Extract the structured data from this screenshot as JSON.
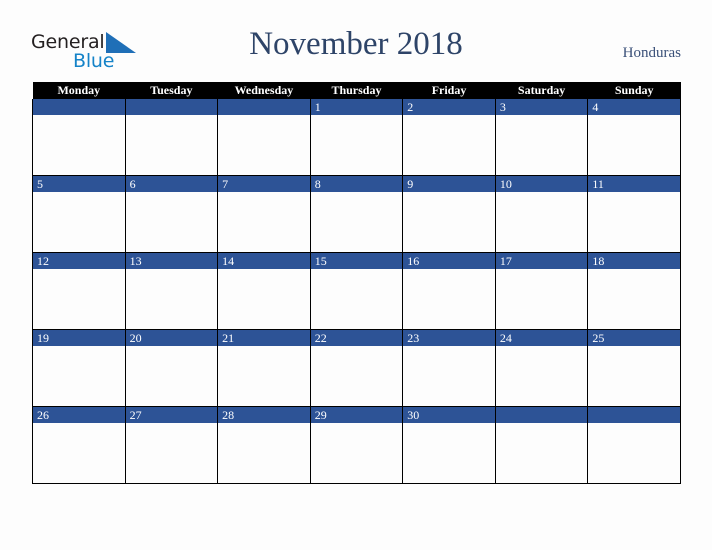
{
  "brand": {
    "name_part1": "General",
    "name_part2": "Blue",
    "triangle_icon": "blue-triangle-icon",
    "accent_color": "#1583c8",
    "text_color": "#231f20"
  },
  "header": {
    "title": "November 2018",
    "region": "Honduras",
    "title_color": "#2e4468",
    "region_color": "#3a5078"
  },
  "calendar": {
    "theme": {
      "header_background": "#000000",
      "header_text": "#ffffff",
      "daynum_band": "#2d5396",
      "daynum_text": "#ffffff",
      "cell_background": "#fdfdfd",
      "grid_line": "#000000"
    },
    "weekday_headers": [
      "Monday",
      "Tuesday",
      "Wednesday",
      "Thursday",
      "Friday",
      "Saturday",
      "Sunday"
    ],
    "weeks": [
      {
        "days": [
          {
            "num": ""
          },
          {
            "num": ""
          },
          {
            "num": ""
          },
          {
            "num": "1"
          },
          {
            "num": "2"
          },
          {
            "num": "3"
          },
          {
            "num": "4"
          }
        ]
      },
      {
        "days": [
          {
            "num": "5"
          },
          {
            "num": "6"
          },
          {
            "num": "7"
          },
          {
            "num": "8"
          },
          {
            "num": "9"
          },
          {
            "num": "10"
          },
          {
            "num": "11"
          }
        ]
      },
      {
        "days": [
          {
            "num": "12"
          },
          {
            "num": "13"
          },
          {
            "num": "14"
          },
          {
            "num": "15"
          },
          {
            "num": "16"
          },
          {
            "num": "17"
          },
          {
            "num": "18"
          }
        ]
      },
      {
        "days": [
          {
            "num": "19"
          },
          {
            "num": "20"
          },
          {
            "num": "21"
          },
          {
            "num": "22"
          },
          {
            "num": "23"
          },
          {
            "num": "24"
          },
          {
            "num": "25"
          }
        ]
      },
      {
        "days": [
          {
            "num": "26"
          },
          {
            "num": "27"
          },
          {
            "num": "28"
          },
          {
            "num": "29"
          },
          {
            "num": "30"
          },
          {
            "num": ""
          },
          {
            "num": ""
          }
        ]
      }
    ]
  }
}
